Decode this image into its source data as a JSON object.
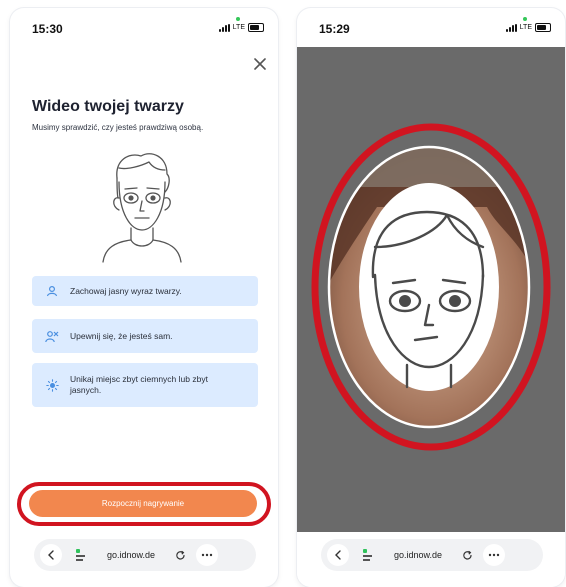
{
  "left_screen": {
    "status": {
      "time": "15:30",
      "network": "LTE"
    },
    "title": "Wideo twojej twarzy",
    "subtitle": "Musimy sprawdzić, czy jesteś prawdziwą osobą.",
    "tips": [
      {
        "icon": "face-expression-icon",
        "text": "Zachowaj jasny wyraz twarzy."
      },
      {
        "icon": "alone-person-icon",
        "text": "Upewnij się, że jesteś sam."
      },
      {
        "icon": "brightness-icon",
        "text": "Unikaj miejsc zbyt ciemnych lub zbyt jasnych."
      }
    ],
    "start_button": "Rozpocznij nagrywanie",
    "browser": {
      "url": "go.idnow.de"
    }
  },
  "right_screen": {
    "status": {
      "time": "15:29",
      "network": "LTE"
    },
    "browser": {
      "url": "go.idnow.de"
    }
  },
  "colors": {
    "accent_orange": "#f2874e",
    "highlight_red": "#d11420",
    "tip_background": "#dcebff",
    "tip_icon_blue": "#4a8fe0",
    "tab_icon_green": "#2fc25b"
  }
}
